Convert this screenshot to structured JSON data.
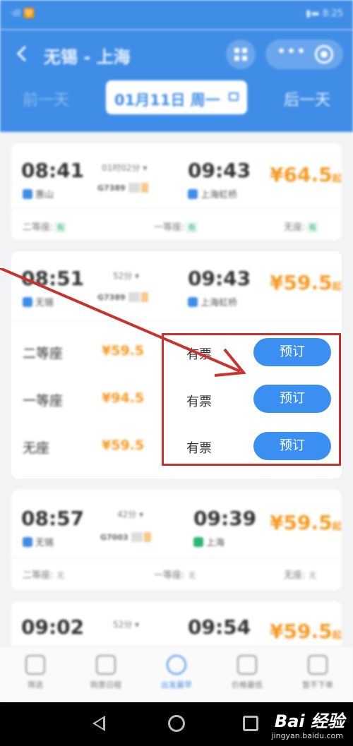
{
  "status_bar": {
    "signal": "‧ıll 🛜",
    "right": "▮▬ 8:25"
  },
  "header": {
    "title": "无锡 - 上海",
    "prev_day": "前一天",
    "next_day": "后一天",
    "date": "01月11日 周一"
  },
  "trains": [
    {
      "dep_time": "08:41",
      "dep_station": "惠山",
      "duration": "01时02分 ▾",
      "train_no": "G7389",
      "arr_time": "09:43",
      "arr_station": "上海虹桥",
      "price": "¥64.5",
      "price_suffix": "起",
      "seats": [
        {
          "label": "二等座:",
          "status": "有"
        },
        {
          "label": "一等座:",
          "status": "有"
        },
        {
          "label": "无座:",
          "status": "有"
        }
      ]
    },
    {
      "dep_time": "08:51",
      "dep_station": "无锡",
      "duration": "52分 ▾",
      "train_no": "G7389",
      "arr_time": "09:43",
      "arr_station": "上海虹桥",
      "price": "¥59.5",
      "price_suffix": "起",
      "expanded": [
        {
          "seat": "二等座",
          "price": "¥59.5",
          "availability": "有票",
          "button": "预订"
        },
        {
          "seat": "一等座",
          "price": "¥94.5",
          "availability": "有票",
          "button": "预订"
        },
        {
          "seat": "无座",
          "price": "¥59.5",
          "availability": "有票",
          "button": "预订"
        }
      ]
    },
    {
      "dep_time": "08:57",
      "dep_station": "无锡",
      "duration": "42分 ▾",
      "train_no": "G7003",
      "arr_time": "09:39",
      "arr_station": "上海",
      "price": "¥59.5",
      "price_suffix": "起",
      "seats": [
        {
          "label": "二等座:",
          "status": "无"
        },
        {
          "label": "一等座:",
          "status": "无"
        },
        {
          "label": "无座:",
          "status": "无"
        }
      ]
    },
    {
      "dep_time": "09:02",
      "duration": "52分 ▾",
      "arr_time": "09:54",
      "price": "¥59.5",
      "price_suffix": "起"
    }
  ],
  "tabbar": [
    "筛选",
    "购票日程",
    "出发最早",
    "价格最低",
    "暂不下单"
  ],
  "watermark": {
    "brand": "Bai 经验",
    "url": "jingyan.baidu.com"
  },
  "colors": {
    "primary": "#3f8de6",
    "price": "#f59a23",
    "annotation": "#c9322d"
  }
}
